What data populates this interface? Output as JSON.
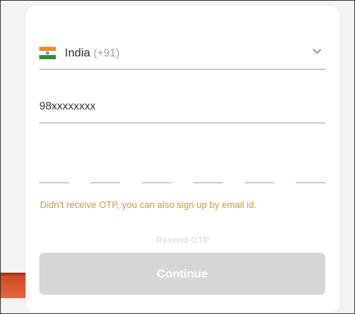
{
  "country_selector": {
    "flag_icon": "india-flag-icon",
    "country_name": "India",
    "dial_code": "(+91)",
    "dropdown_icon": "chevron-down-icon"
  },
  "phone": {
    "value": "98xxxxxxxx"
  },
  "otp": {
    "digits": [
      "",
      "",
      "",
      "",
      "",
      ""
    ]
  },
  "hint_text": "Didn’t receive OTP, you can also sign up by email id.",
  "resend_label": "Resend OTP",
  "continue_label": "Continue",
  "colors": {
    "hint": "#d19443",
    "button_bg": "#d6d6d6",
    "resend": "#e2e2e2",
    "flag_saffron": "#f08a24",
    "flag_green": "#2e8b3d"
  }
}
